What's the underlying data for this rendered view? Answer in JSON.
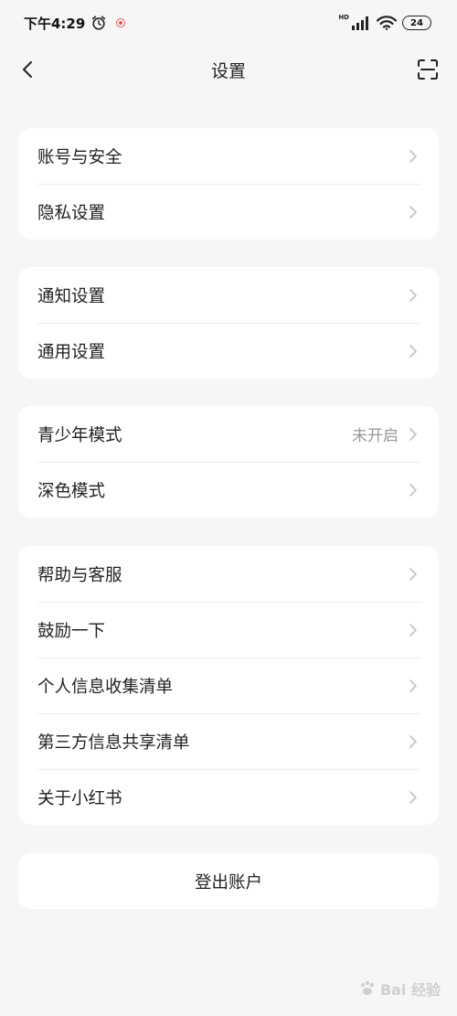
{
  "status_bar": {
    "time": "下午4:29",
    "battery": "24",
    "hd_label": "HD"
  },
  "nav": {
    "title": "设置"
  },
  "groups": [
    {
      "items": [
        {
          "label": "账号与安全",
          "value": ""
        },
        {
          "label": "隐私设置",
          "value": ""
        }
      ]
    },
    {
      "items": [
        {
          "label": "通知设置",
          "value": ""
        },
        {
          "label": "通用设置",
          "value": ""
        }
      ]
    },
    {
      "items": [
        {
          "label": "青少年模式",
          "value": "未开启"
        },
        {
          "label": "深色模式",
          "value": ""
        }
      ]
    },
    {
      "items": [
        {
          "label": "帮助与客服",
          "value": ""
        },
        {
          "label": "鼓励一下",
          "value": ""
        },
        {
          "label": "个人信息收集清单",
          "value": ""
        },
        {
          "label": "第三方信息共享清单",
          "value": ""
        },
        {
          "label": "关于小红书",
          "value": ""
        }
      ]
    }
  ],
  "logout": {
    "label": "登出账户"
  },
  "watermark": {
    "text": "Bai 经验"
  },
  "icons": {
    "back": "chevron-left-icon",
    "scan": "scan-icon",
    "row_arrow": "chevron-right-icon",
    "alarm": "alarm-clock-icon",
    "signal": "signal-icon",
    "wifi": "wifi-icon"
  },
  "colors": {
    "background": "#f6f6f6",
    "card": "#ffffff",
    "secondary_text": "#999999",
    "chevron": "#c4c4c4"
  }
}
